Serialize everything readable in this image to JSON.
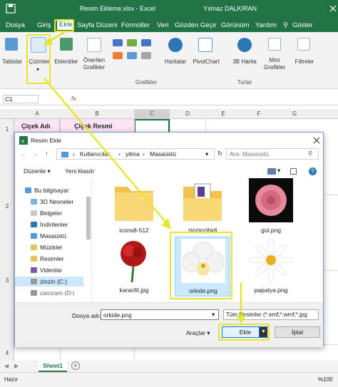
{
  "window": {
    "title": "Resim Ekleme.xlsx  -  Excel",
    "user": "Yılmaz DALKIRAN"
  },
  "menu": {
    "items": [
      "Dosya",
      "Giriş",
      "Ekle",
      "Sayfa Düzeni",
      "Formüller",
      "Veri",
      "Gözden Geçir",
      "Görünüm",
      "Yardım"
    ],
    "tell_me": "Göster"
  },
  "ribbon": {
    "tablolar": "Tablolar",
    "cizimler": "Çizimler",
    "eklentiler": "Eklentiler",
    "onerilen": "Önerilen\nGrafikler",
    "haritalar": "Haritalar",
    "pivotchart": "PivotChart",
    "harita3d": "3B Harita",
    "mini": "Mini\nGrafikler",
    "filtreler": "Filtreler",
    "group_grafikler": "Grafikler",
    "group_turlar": "Turlar"
  },
  "formula_bar": {
    "name_box": "C1",
    "fx": "fx"
  },
  "columns": [
    "A",
    "B",
    "C",
    "D",
    "E",
    "F",
    "G"
  ],
  "rows": [
    "1",
    "2",
    "3",
    "4"
  ],
  "cells": {
    "a1": "Çiçek Adı",
    "b1": "Çiçek Resmi"
  },
  "dialog": {
    "title": "Resim Ekle",
    "breadcrumb": [
      "Kullanıcılar",
      "yilma",
      "Masaüstü"
    ],
    "search_placeholder": "Ara: Masaüstü",
    "toolbar": {
      "organize": "Düzenle",
      "new_folder": "Yeni klasör"
    },
    "nav": [
      "Bu bilgisayar",
      "3D Nesneler",
      "Belgeler",
      "İndirilenler",
      "Masaüstü",
      "Müzikler",
      "Resimler",
      "Videolar",
      "zinzin (C:)",
      "zamzam (D:)"
    ],
    "files": [
      {
        "name": "icons8-512",
        "kind": "folder"
      },
      {
        "name": "zinzinzibidi",
        "kind": "folder"
      },
      {
        "name": "gül.png",
        "kind": "rose"
      },
      {
        "name": "karanfil.jpg",
        "kind": "carnation"
      },
      {
        "name": "orkide.png",
        "kind": "orchid"
      },
      {
        "name": "papatya.png",
        "kind": "daisy"
      }
    ],
    "filename_label": "Dosya adı:",
    "filename_value": "orkide.png",
    "filetype_value": "Tüm Resimler (*.emf;*.wmf;*.jpg",
    "tools_label": "Araçlar",
    "insert_label": "Ekle",
    "cancel_label": "İptal"
  },
  "sheet": {
    "tab": "Sheet1"
  },
  "status": {
    "ready": "Hazır",
    "zoom": "%100"
  },
  "colors": {
    "excel_green": "#217346",
    "highlight": "#e7e62c",
    "selection": "#cce8ff"
  }
}
